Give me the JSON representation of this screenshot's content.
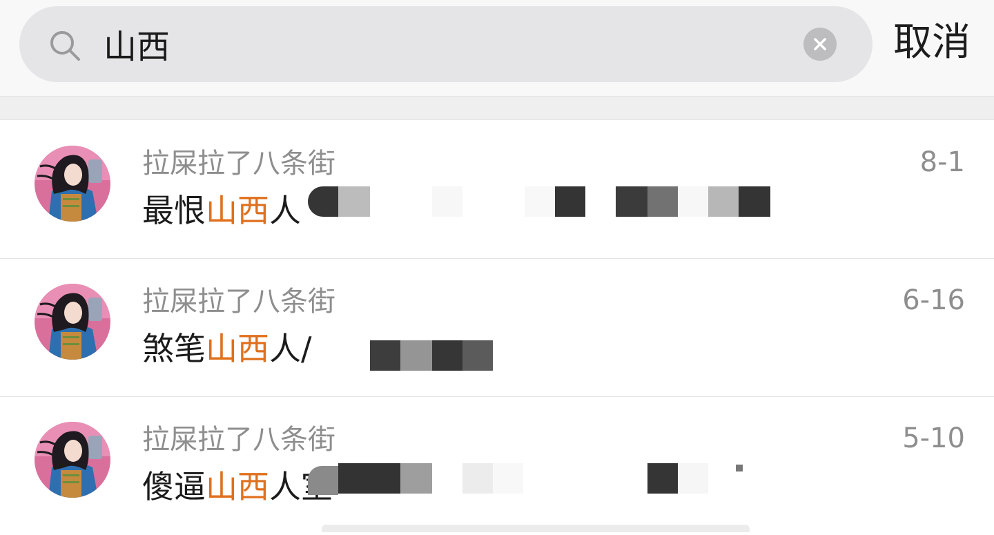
{
  "search": {
    "query": "山西",
    "cancel_label": "取消"
  },
  "results": [
    {
      "sender": "拉屎拉了八条街",
      "prefix": "最恨",
      "highlight": "山西",
      "suffix": "人",
      "date": "8-1"
    },
    {
      "sender": "拉屎拉了八条街",
      "prefix": "煞笔",
      "highlight": "山西",
      "suffix": "人/",
      "date": "6-16"
    },
    {
      "sender": "拉屎拉了八条街",
      "prefix": "傻逼",
      "highlight": "山西",
      "suffix": "人室",
      "date": "5-10"
    }
  ],
  "colors": {
    "highlight": "#e0701d",
    "search_bg": "#e5e5e7",
    "meta_text": "#8e8e8e",
    "body_text": "#1b1b1b"
  },
  "icons": {
    "search": "search-icon",
    "clear": "clear-icon",
    "avatar": "avatar"
  }
}
